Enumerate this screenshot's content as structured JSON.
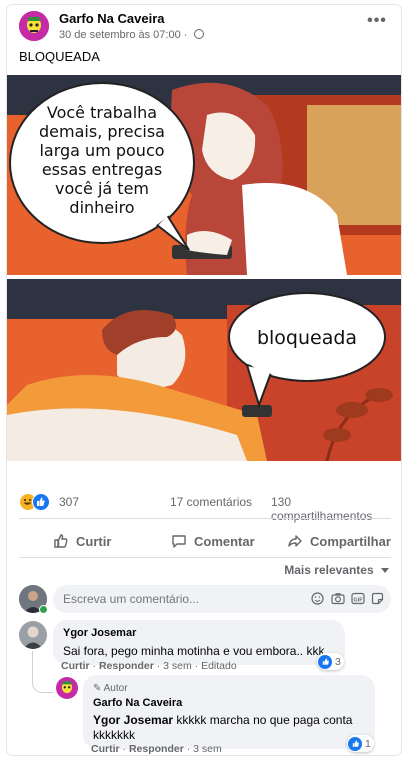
{
  "post": {
    "page_name": "Garfo Na Caveira",
    "timestamp": "30 de setembro às 07:00",
    "separator": "·",
    "text": "BLOQUEADA",
    "more_label": "•••"
  },
  "meme": {
    "top_caption": [
      "Você trabalha",
      "demais, precisa",
      "larga um pouco",
      "essas entregas",
      "você já tem",
      "dinheiro"
    ],
    "bottom_caption": "bloqueada"
  },
  "stats": {
    "reactions_count": "307",
    "comments": "17 comentários",
    "shares": "130 compartilhamentos",
    "reaction_icons": [
      "haha-icon",
      "like-icon"
    ]
  },
  "actions": {
    "like": "Curtir",
    "comment": "Comentar",
    "share": "Compartilhar"
  },
  "sort_label": "Mais relevantes",
  "composer": {
    "placeholder": "Escreva um comentário..."
  },
  "comments": [
    {
      "author": "Ygor Josemar",
      "text": "Sai fora, pego minha motinha e vou embora.. kkk",
      "like": "Curtir",
      "reply": "Responder",
      "age": "3 sem",
      "edited": "Editado",
      "reactions": "3"
    }
  ],
  "reply": {
    "badge": "Autor",
    "author": "Garfo Na Caveira",
    "mention": "Ygor Josemar",
    "text_line1": " kkkkk marcha no que paga conta",
    "text_line2": "kkkkkkk",
    "like": "Curtir",
    "reply": "Responder",
    "age": "3 sem",
    "reactions": "1"
  },
  "colors": {
    "brand_blue": "#1877f2",
    "meta_gray": "#65676b",
    "bubble_bg": "#f0f2f5",
    "meme_orange": "#e85f2e"
  }
}
